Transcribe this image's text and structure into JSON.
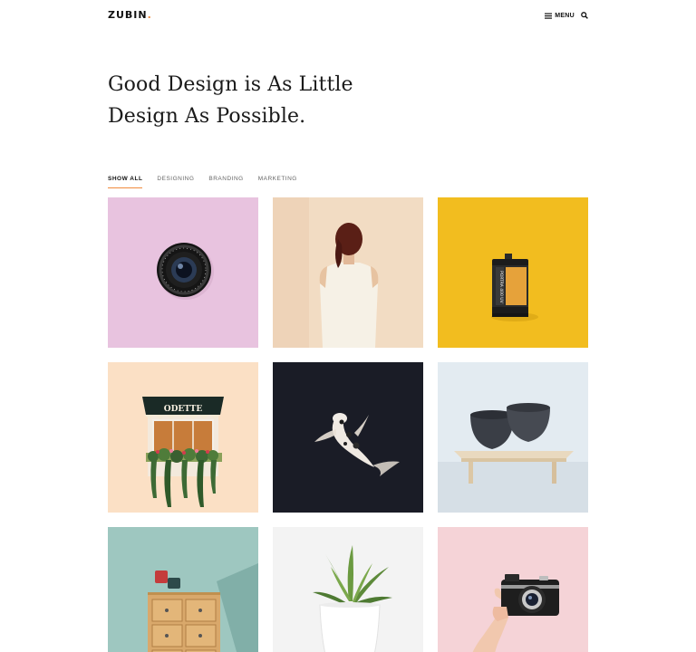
{
  "header": {
    "logo_text": "ZUBIN",
    "logo_dot": ".",
    "menu_label": "MENU",
    "menu_icon": "hamburger-icon",
    "search_icon": "search-icon"
  },
  "hero": {
    "line1": "Good Design is As Little",
    "line2": "Design As Possible."
  },
  "filters": [
    {
      "label": "SHOW ALL",
      "active": true
    },
    {
      "label": "DESIGNING",
      "active": false
    },
    {
      "label": "BRANDING",
      "active": false
    },
    {
      "label": "MARKETING",
      "active": false
    }
  ],
  "portfolio": {
    "awning_text": "ODETTE",
    "film_text": "PORTRA 400 UV"
  },
  "colors": {
    "accent": "#f08a3c",
    "tile_pink": "#e8c3df",
    "tile_beige": "#f2dcc3",
    "tile_yellow": "#f2bd1f",
    "tile_peach": "#fbe0c5",
    "tile_dark": "#1a1c26",
    "tile_lightblue": "#e3ebf1",
    "tile_teal": "#9ec7c0",
    "tile_white": "#f3f3f3",
    "tile_rose": "#f5d3d7"
  }
}
